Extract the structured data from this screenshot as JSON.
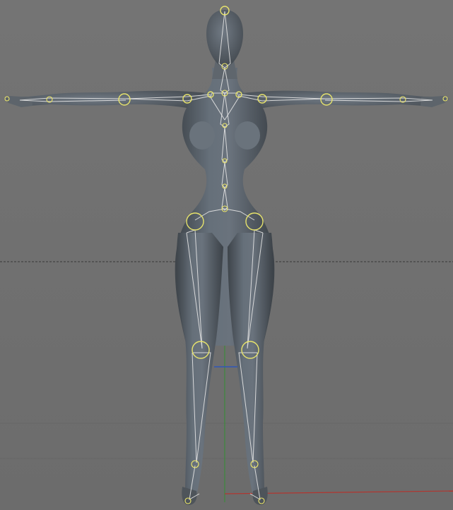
{
  "viewport": {
    "background": "#6f6f6f",
    "mesh_color": "#5b6168",
    "bone_color": "#e4e4e4",
    "joint_color": "#e7e36c",
    "horizon_style": "dashed",
    "axis_colors": {
      "x": "#b2352f",
      "y": "#3c8a3c",
      "z": "#2f56b8"
    }
  },
  "scene": {
    "model": "female-base-mesh",
    "pose": "T-pose",
    "rig": "skeleton-overlay"
  }
}
